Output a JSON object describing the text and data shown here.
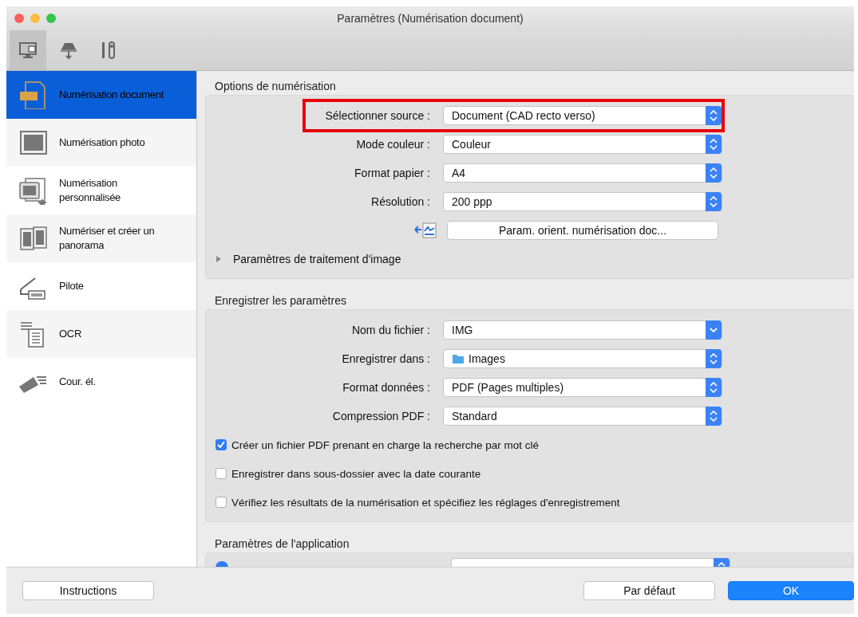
{
  "window": {
    "title": "Paramètres (Numérisation document)"
  },
  "toolbar_tabs": [
    {
      "kind": "computer",
      "selected": true
    },
    {
      "kind": "scanner",
      "selected": false
    },
    {
      "kind": "tools",
      "selected": false
    }
  ],
  "sidebar": {
    "items": [
      {
        "kind": "pdf",
        "label": "Numérisation document",
        "selected": true
      },
      {
        "kind": "photo",
        "label": "Numérisation photo",
        "selected": false
      },
      {
        "kind": "custom",
        "label": "Numérisation personnalisée",
        "selected": false
      },
      {
        "kind": "stitch",
        "label": "Numériser et créer un panorama",
        "selected": false
      },
      {
        "kind": "driver",
        "label": "Pilote",
        "selected": false
      },
      {
        "kind": "ocr",
        "label": "OCR",
        "selected": false
      },
      {
        "kind": "mail",
        "label": "Cour. él.",
        "selected": false
      }
    ]
  },
  "sections": [
    {
      "title": "Options de numérisation",
      "fields": [
        {
          "kind": "popup",
          "label": "Sélectionner source :",
          "value": "Document (CAD recto verso)",
          "highlighted": true
        },
        {
          "kind": "popup",
          "label": "Mode couleur :",
          "value": "Couleur",
          "highlighted": false
        },
        {
          "kind": "popup",
          "label": "Format papier :",
          "value": "A4",
          "highlighted": false
        },
        {
          "kind": "popup",
          "label": "Résolution :",
          "value": "200 ppp",
          "highlighted": false
        },
        {
          "kind": "button",
          "label": "Param. orient. numérisation doc..."
        },
        {
          "kind": "disclosure",
          "label": "Paramètres de traitement d'image",
          "expanded": false
        }
      ]
    },
    {
      "title": "Enregistrer les paramètres",
      "fields": [
        {
          "kind": "combo",
          "label": "Nom du fichier :",
          "value": "IMG"
        },
        {
          "kind": "folder_popup",
          "label": "Enregistrer dans :",
          "value": "Images",
          "highlighted": false
        },
        {
          "kind": "popup",
          "label": "Format données :",
          "value": "PDF (Pages multiples)",
          "highlighted": false
        },
        {
          "kind": "popup",
          "label": "Compression PDF :",
          "value": "Standard",
          "highlighted": false
        },
        {
          "kind": "checkbox",
          "label": "Créer un fichier PDF prenant en charge la recherche par mot clé",
          "checked": true
        },
        {
          "kind": "checkbox",
          "label": "Enregistrer dans sous-dossier avec la date courante",
          "checked": false
        },
        {
          "kind": "checkbox",
          "label": "Vérifiez les résultats de la numérisation et spécifiez les réglages d'enregistrement",
          "checked": false
        }
      ]
    },
    {
      "title": "Paramètres de l'application",
      "fields": [
        {
          "kind": "radio_popup",
          "selected": true
        }
      ]
    }
  ],
  "buttons": [
    {
      "label": "Instructions",
      "default": false
    },
    {
      "label": "Par défaut",
      "default": false
    },
    {
      "label": "OK",
      "default": true
    }
  ]
}
